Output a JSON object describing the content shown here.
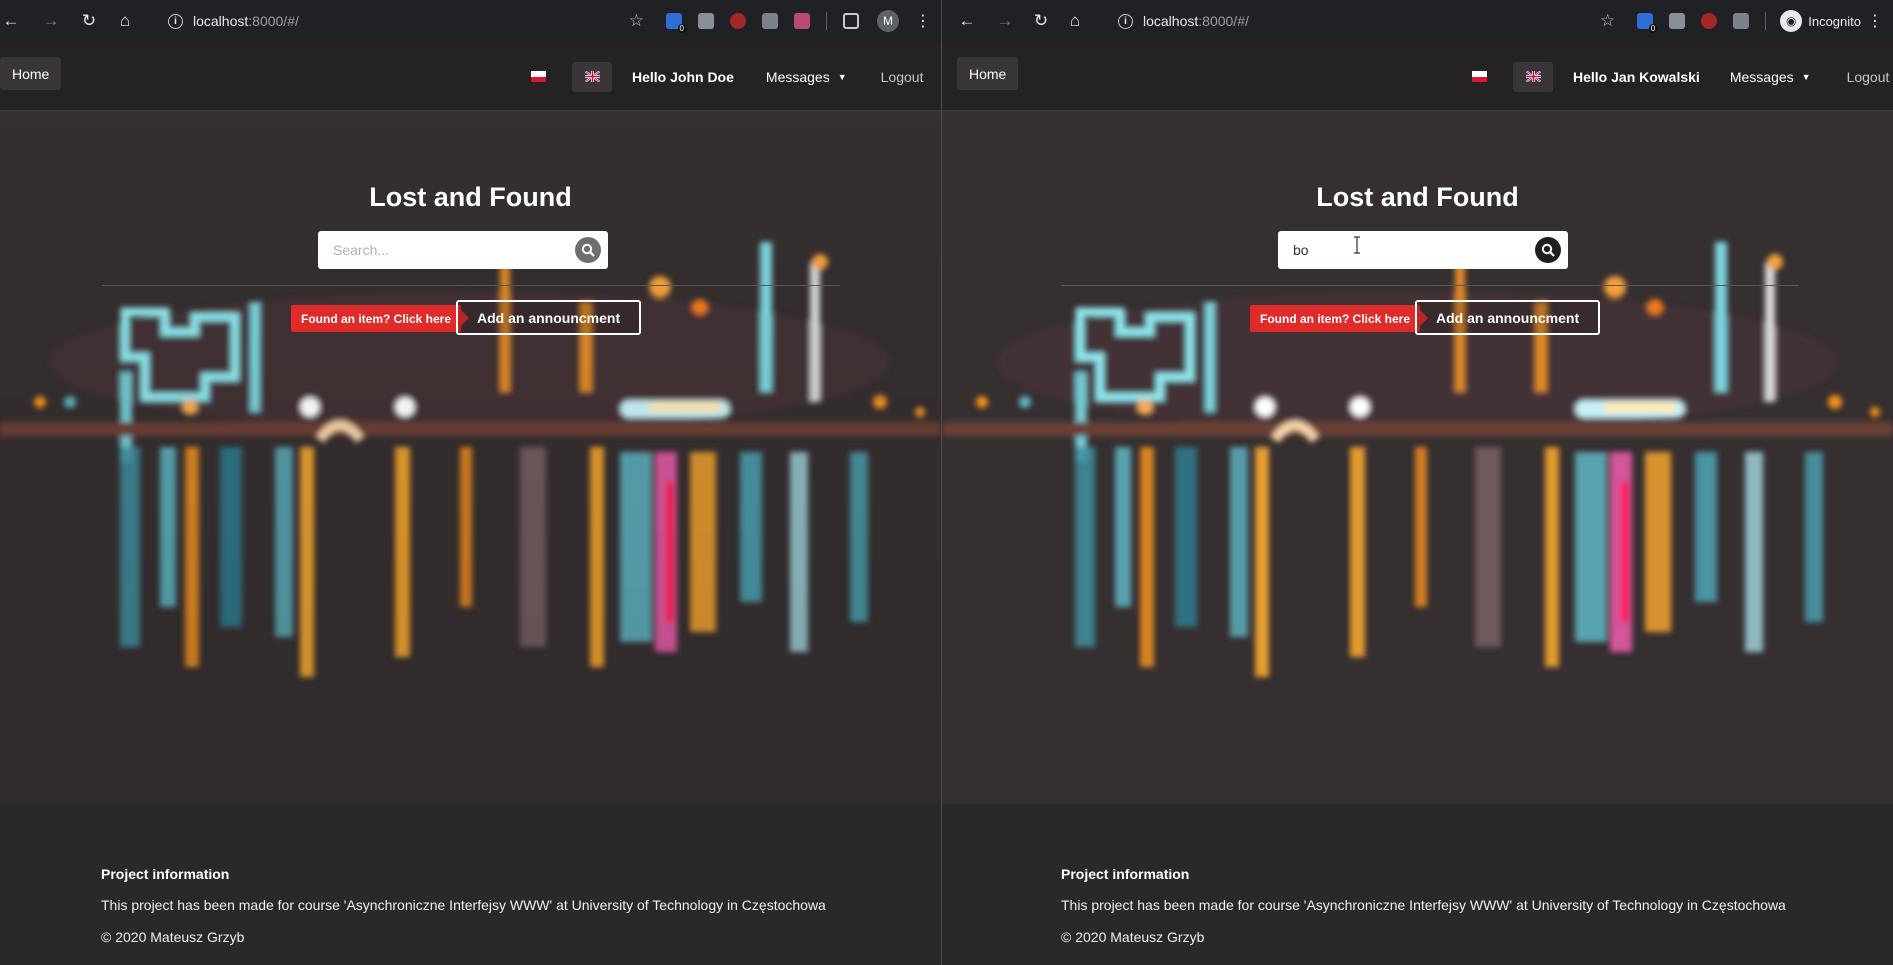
{
  "browser_left": {
    "url_host": "localhost",
    "url_path": ":8000/#/",
    "profile_initial": "M",
    "ext_badge": "0"
  },
  "browser_right": {
    "url_host": "localhost",
    "url_path": ":8000/#/",
    "incognito_label": "Incognito",
    "ext_badge": "0"
  },
  "app_left": {
    "nav": {
      "home": "Home",
      "greeting": "Hello John Doe",
      "messages": "Messages",
      "logout": "Logout"
    },
    "title": "Lost and Found",
    "search": {
      "placeholder": "Search...",
      "value": ""
    },
    "found_tag": "Found an item? Click here",
    "add_button": "Add an announcment"
  },
  "app_right": {
    "nav": {
      "home": "Home",
      "greeting": "Hello Jan Kowalski",
      "messages": "Messages",
      "logout": "Logout"
    },
    "title": "Lost and Found",
    "search": {
      "placeholder": "Search...",
      "value": "bo"
    },
    "found_tag": "Found an item? Click here",
    "add_button": "Add an announcment"
  },
  "footer": {
    "title": "Project information",
    "description": "This project has been made for course 'Asynchroniczne Interfejsy WWW' at University of Technology in Częstochowa",
    "copyright": "© 2020 Mateusz Grzyb"
  },
  "colors": {
    "found_tag": "#e02b2b",
    "navbar": "#252222",
    "footer": "#2a2828"
  }
}
